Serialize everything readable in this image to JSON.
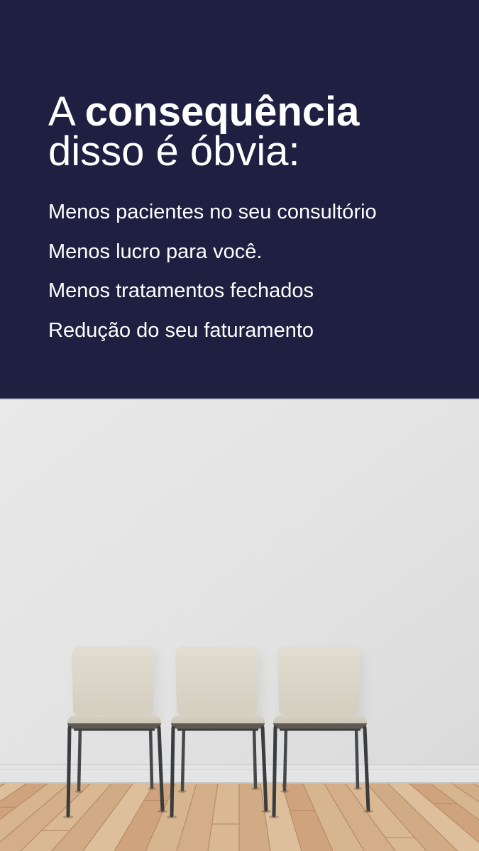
{
  "colors": {
    "panel_background": "#1e1f41",
    "text": "#ffffff"
  },
  "headline": {
    "prefix": "A",
    "emphasis": "consequência",
    "line2": "disso é óbvia:"
  },
  "items": [
    "Menos pacientes no seu consultório",
    "Menos lucro para você.",
    "Menos tratamentos fechados",
    "Redução do seu faturamento"
  ]
}
